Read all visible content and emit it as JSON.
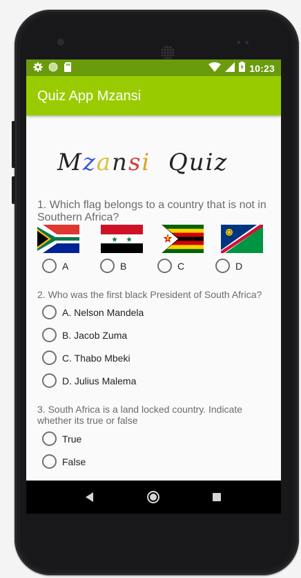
{
  "status_bar": {
    "time": "10:23",
    "left_icons": [
      "gear-icon",
      "circle-icon",
      "sd-card-icon"
    ],
    "right_icons": [
      "wifi-icon",
      "signal-icon",
      "battery-charging-icon"
    ]
  },
  "app_bar": {
    "title": "Quiz App Mzansi"
  },
  "logo": {
    "text": "Mzansi Quiz"
  },
  "questions": [
    {
      "text": "1. Which flag belongs to a country that is not in Southern Africa?",
      "options": [
        {
          "label": "A",
          "flag": "south-africa-flag"
        },
        {
          "label": "B",
          "flag": "syria-flag"
        },
        {
          "label": "C",
          "flag": "zimbabwe-flag"
        },
        {
          "label": "D",
          "flag": "namibia-flag"
        }
      ]
    },
    {
      "text": "2. Who was the first black President of South Africa?",
      "options": [
        {
          "label": "A. Nelson Mandela"
        },
        {
          "label": "B. Jacob Zuma"
        },
        {
          "label": "C. Thabo Mbeki"
        },
        {
          "label": "D. Julius Malema"
        }
      ]
    },
    {
      "text": "3. South Africa is a land locked country. Indicate whether its true or false",
      "options": [
        {
          "label": "True"
        },
        {
          "label": "False"
        }
      ]
    }
  ],
  "colors": {
    "status_bar": "#6a9b0d",
    "app_bar": "#99cc00",
    "question_text": "#6b6b6b"
  },
  "nav_bar": {
    "buttons": [
      "back-icon",
      "home-icon",
      "recents-icon"
    ]
  }
}
